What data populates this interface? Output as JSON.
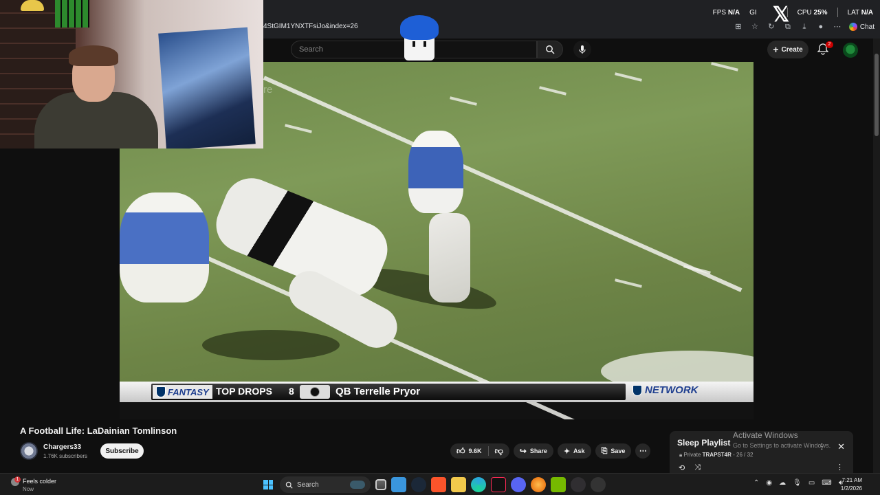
{
  "perf_overlay": {
    "fps_label": "FPS",
    "fps_value": "N/A",
    "gpu_label": "GI",
    "cpu_label": "CPU",
    "cpu_value": "25%",
    "lat_label": "LAT",
    "lat_value": "N/A"
  },
  "browser": {
    "url_fragment": "4StGIM1YNXTFsiJo&index=26",
    "chat_label": "Chat"
  },
  "youtube_header": {
    "search_placeholder": "Search",
    "create_label": "Create",
    "notification_count": "2"
  },
  "video": {
    "overlay_ghost_text": "re",
    "lower_third": {
      "brand": "FANTASY",
      "segment": "TOP DROPS",
      "rank": "8",
      "player": "QB Terrelle Pryor",
      "network": "NETWORK"
    }
  },
  "watch": {
    "title": "A Football Life: LaDainian Tomlinson",
    "channel_name": "Chargers33",
    "channel_subs": "1.76K subscribers",
    "subscribe_label": "Subscribe",
    "like_count": "9.6K",
    "share_label": "Share",
    "ask_label": "Ask",
    "save_label": "Save"
  },
  "playlist": {
    "title": "Sleep Playlist",
    "privacy": "Private",
    "owner": "TRAPST4R",
    "position": "26 / 32"
  },
  "watermark": {
    "title": "Activate Windows",
    "subtitle": "Go to Settings to activate Windows."
  },
  "taskbar": {
    "weather_title": "Feels colder",
    "weather_sub": "Now",
    "weather_badge": "1",
    "search_label": "Search",
    "time": "7:21 AM",
    "date": "1/2/2026"
  },
  "colors": {
    "youtube_bg": "#0f0f0f",
    "notification_red": "#cc0000",
    "field_green": "#7f9a58",
    "windows_accent": "#4cc2ff"
  }
}
